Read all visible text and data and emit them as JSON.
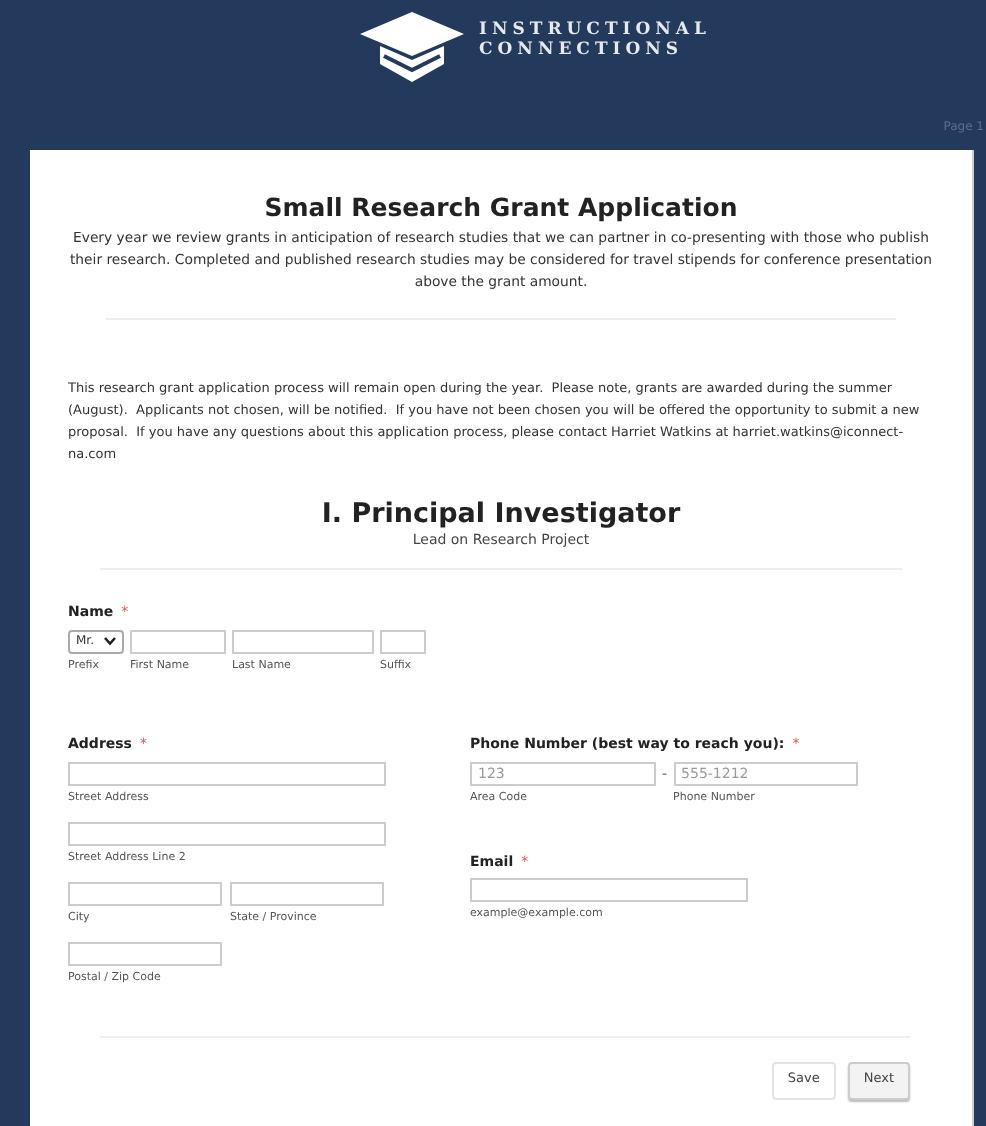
{
  "header": {
    "logo_lines": [
      "INSTRUCTIONAL",
      "CONNECTIONS"
    ],
    "page_indicator": "Page 1"
  },
  "form": {
    "title": "Small Research Grant Application",
    "intro": "Every year we review grants in anticipation of research studies that we can partner in co-presenting with those who publish their research. Completed and published research studies may be considered for travel stipends for conference presentation above the grant amount.",
    "notice": "This research grant application process will remain open during the year.  Please note, grants are awarded during the summer (August).  Applicants not chosen, will be notified.  If you have not been chosen you will be offered the opportunity to submit a new proposal.  If you have any questions about this application process, please contact Harriet Watkins at harriet.watkins@iconnect-na.com",
    "section": {
      "title": "I. Principal Investigator",
      "subtitle": "Lead on Research Project"
    },
    "name": {
      "label": "Name",
      "required_mark": "*",
      "prefix": {
        "value": "Mr.",
        "sublabel": "Prefix"
      },
      "first_sublabel": "First Name",
      "last_sublabel": "Last Name",
      "suffix_sublabel": "Suffix"
    },
    "address": {
      "label": "Address",
      "required_mark": "*",
      "sublabels": [
        "Street Address",
        "Street Address Line 2",
        "City",
        "State / Province",
        "Postal / Zip Code"
      ]
    },
    "phone": {
      "label": "Phone Number (best way to reach you):",
      "required_mark": "*",
      "area_placeholder": "123",
      "separator": "-",
      "number_placeholder": "555-1212",
      "area_sublabel": "Area Code",
      "number_sublabel": "Phone Number"
    },
    "email": {
      "label": "Email",
      "required_mark": "*",
      "sublabel": "example@example.com"
    },
    "buttons": [
      {
        "label": "Save",
        "kind": "secondary"
      },
      {
        "label": "Next",
        "kind": "primary"
      }
    ]
  }
}
